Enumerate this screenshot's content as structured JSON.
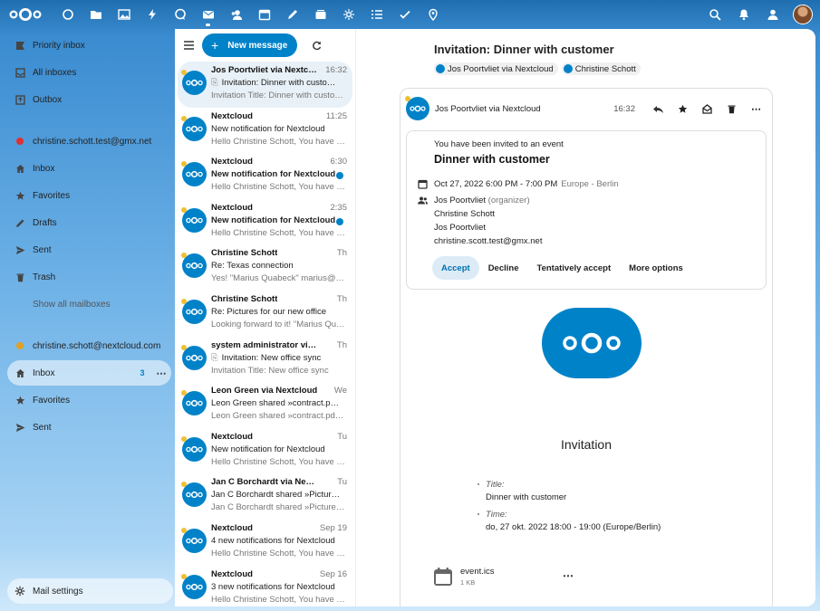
{
  "topbar": {
    "apps": [
      "dashboard",
      "files",
      "photos",
      "activity",
      "talk",
      "mail",
      "contacts",
      "calendar",
      "notes",
      "deck",
      "bubble",
      "tasks",
      "checks",
      "maps"
    ],
    "active_app": "mail"
  },
  "nav": {
    "top": [
      {
        "label": "Priority inbox",
        "icon": "priority-icon"
      },
      {
        "label": "All inboxes",
        "icon": "inbox-icon"
      },
      {
        "label": "Outbox",
        "icon": "outbox-icon"
      }
    ],
    "account1": {
      "name": "christine.schott.test@gmx.net",
      "color": "#e03030",
      "folders": [
        "Inbox",
        "Favorites",
        "Drafts",
        "Sent",
        "Trash"
      ],
      "show_all": "Show all mailboxes"
    },
    "account2": {
      "name": "christine.schott@nextcloud.com",
      "color": "#e0a020",
      "folders": [
        {
          "label": "Inbox",
          "count": "3"
        },
        {
          "label": "Favorites"
        },
        {
          "label": "Sent"
        }
      ]
    },
    "settings": "Mail settings"
  },
  "list": {
    "new_message": "New message",
    "messages": [
      {
        "from": "Jos Poortvliet via Nextcloud",
        "time": "16:32",
        "subject": "Invitation: Dinner with customer",
        "preview": "Invitation  Title: Dinner with customer",
        "attachment": true,
        "unread": false
      },
      {
        "from": "Nextcloud",
        "time": "11:25",
        "subject": "New notification for Nextcloud",
        "preview": "Hello Christine Schott,  You have a new notification",
        "unread": false
      },
      {
        "from": "Nextcloud",
        "time": "6:30",
        "subject": "New notification for Nextcloud",
        "preview": "Hello Christine Schott,  You have a new notification",
        "unread": true
      },
      {
        "from": "Nextcloud",
        "time": "2:35",
        "subject": "New notification for Nextcloud",
        "preview": "Hello Christine Schott,  You have a new notification",
        "unread": true
      },
      {
        "from": "Christine Schott",
        "time": "Th",
        "subject": "Re: Texas connection",
        "preview": "Yes!  \"Marius Quabeck\" marius@quabeck.de",
        "unread": false
      },
      {
        "from": "Christine Schott",
        "time": "Th",
        "subject": "Re: Pictures for our new office",
        "preview": "Looking forward to it!  \"Marius Quabeck\"",
        "unread": false
      },
      {
        "from": "system administrator via Nextcloud",
        "time": "Th",
        "subject": "Invitation: New office sync",
        "preview": "Invitation  Title: New office sync",
        "attachment": true,
        "unread": false
      },
      {
        "from": "Leon Green via Nextcloud",
        "time": "We",
        "subject": "Leon Green shared »contract.pdf«",
        "preview": "Leon Green shared »contract.pdf« with you",
        "unread": false
      },
      {
        "from": "Nextcloud",
        "time": "Tu",
        "subject": "New notification for Nextcloud",
        "preview": "Hello Christine Schott,  You have a new notification",
        "unread": false
      },
      {
        "from": "Jan C Borchardt via Nextcloud",
        "time": "Tu",
        "subject": "Jan C Borchardt shared »Pictures«",
        "preview": "Jan C Borchardt shared »Pictures« with you",
        "unread": false
      },
      {
        "from": "Nextcloud",
        "time": "Sep 19",
        "subject": "4 new notifications for Nextcloud",
        "preview": "Hello Christine Schott,  You have new notifications",
        "unread": false
      },
      {
        "from": "Nextcloud",
        "time": "Sep 16",
        "subject": "3 new notifications for Nextcloud",
        "preview": "Hello Christine Schott,  You have new notifications",
        "unread": false
      }
    ]
  },
  "pane": {
    "title": "Invitation: Dinner with customer",
    "recipients": [
      "Jos Poortvliet via Nextcloud",
      "Christine Schott"
    ],
    "sender": "Jos Poortvliet via Nextcloud",
    "time": "16:32",
    "invite": {
      "intro": "You have been invited to an event",
      "title": "Dinner with customer",
      "when": "Oct 27, 2022 6:00 PM - 7:00 PM",
      "timezone": "Europe - Berlin",
      "organizer": "Jos Poortvliet",
      "organizer_tag": "(organizer)",
      "attendees": [
        "Christine Schott",
        "Jos Poortvliet",
        "christine.scott.test@gmx.net"
      ],
      "actions": [
        "Accept",
        "Decline",
        "Tentatively accept",
        "More options"
      ]
    },
    "body": {
      "heading": "Invitation",
      "title_label": "Title:",
      "title_value": "Dinner with customer",
      "time_label": "Time:",
      "time_value": "do, 27 okt. 2022 18:00 - 19:00 (Europe/Berlin)"
    },
    "attachment": {
      "name": "event.ics",
      "size": "1 KB"
    }
  },
  "colors": {
    "brand": "#0082c9",
    "unread_dot": "#0082c9",
    "accept_bg": "#dcebf6"
  }
}
